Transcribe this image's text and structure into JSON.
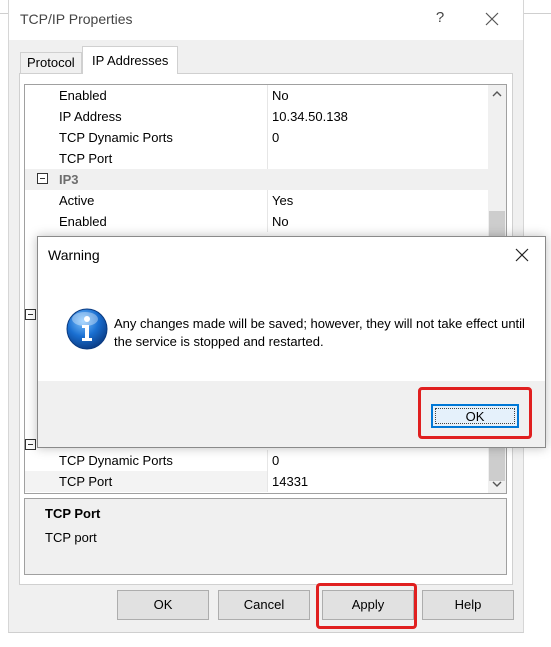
{
  "window": {
    "title": "TCP/IP Properties",
    "help_glyph": "?",
    "tabs": [
      {
        "label": "Protocol",
        "active": false
      },
      {
        "label": "IP Addresses",
        "active": true
      }
    ]
  },
  "grid": {
    "rows": [
      {
        "name": "Enabled",
        "value": "No"
      },
      {
        "name": "IP Address",
        "value": "10.34.50.138"
      },
      {
        "name": "TCP Dynamic Ports",
        "value": "0"
      },
      {
        "name": "TCP Port",
        "value": ""
      },
      {
        "category": "IP3"
      },
      {
        "name": "Active",
        "value": "Yes"
      },
      {
        "name": "Enabled",
        "value": "No"
      },
      {
        "name": "TCP Dynamic Ports",
        "value": "0"
      },
      {
        "name": "TCP Port",
        "value": "14331"
      }
    ]
  },
  "description": {
    "title": "TCP Port",
    "text": "TCP port"
  },
  "buttons": {
    "ok": "OK",
    "cancel": "Cancel",
    "apply": "Apply",
    "help": "Help"
  },
  "warning_dialog": {
    "title": "Warning",
    "message": "Any changes made will be saved; however, they will not take effect until the service is stopped and restarted.",
    "ok": "OK"
  },
  "colors": {
    "highlight": "#e01f1f",
    "focus_border": "#0078d7"
  }
}
